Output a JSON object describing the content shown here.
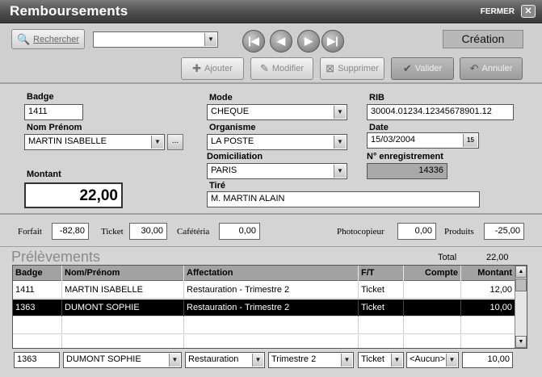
{
  "window": {
    "title": "Remboursements",
    "close_label": "FERMER",
    "close_glyph": "✕"
  },
  "toolbar": {
    "search_label": "Rechercher",
    "search_value": "",
    "nav": [
      "|◀",
      "◀",
      "▶",
      "▶|"
    ],
    "mode_label": "Création",
    "add_label": "Ajouter",
    "edit_label": "Modifier",
    "delete_label": "Supprimer",
    "validate_label": "Valider",
    "cancel_label": "Annuler"
  },
  "form": {
    "badge": {
      "label": "Badge",
      "value": "1411"
    },
    "nom": {
      "label": "Nom Prénom",
      "value": "MARTIN ISABELLE",
      "btn": "..."
    },
    "montant": {
      "label": "Montant",
      "value": "22,00"
    },
    "mode": {
      "label": "Mode",
      "value": "CHEQUE"
    },
    "organisme": {
      "label": "Organisme",
      "value": "LA POSTE"
    },
    "domiciliation": {
      "label": "Domiciliation",
      "value": "PARIS"
    },
    "tire": {
      "label": "Tiré",
      "value": "M. MARTIN ALAIN"
    },
    "rib": {
      "label": "RIB",
      "value": "30004.01234.12345678901.12"
    },
    "date": {
      "label": "Date",
      "value": "15/03/2004",
      "cal": "15"
    },
    "enreg": {
      "label": "N° enregistrement",
      "value": "14336"
    }
  },
  "totals": {
    "forfait": {
      "label": "Forfait",
      "value": "-82,80"
    },
    "ticket": {
      "label": "Ticket",
      "value": "30,00"
    },
    "cafeteria": {
      "label": "Cafétéria",
      "value": "0,00"
    },
    "photocopieur": {
      "label": "Photocopieur",
      "value": "0,00"
    },
    "produits": {
      "label": "Produits",
      "value": "-25,00"
    }
  },
  "prelevements": {
    "title": "Prélèvements",
    "total_label": "Total",
    "total_value": "22,00",
    "columns": [
      "Badge",
      "Nom/Prénom",
      "Affectation",
      "F/T",
      "Compte",
      "Montant"
    ],
    "rows": [
      {
        "badge": "1411",
        "nom": "MARTIN ISABELLE",
        "affectation": "Restauration - Trimestre 2",
        "ft": "Ticket",
        "compte": "",
        "montant": "12,00",
        "selected": false
      },
      {
        "badge": "1363",
        "nom": "DUMONT SOPHIE",
        "affectation": "Restauration - Trimestre 2",
        "ft": "Ticket",
        "compte": "",
        "montant": "10,00",
        "selected": true
      }
    ],
    "edit_row": {
      "badge": "1363",
      "nom": "DUMONT SOPHIE",
      "affectation": "Restauration",
      "trimestre": "Trimestre 2",
      "ft": "Ticket",
      "compte": "<Aucun>",
      "montant": "10,00"
    }
  }
}
